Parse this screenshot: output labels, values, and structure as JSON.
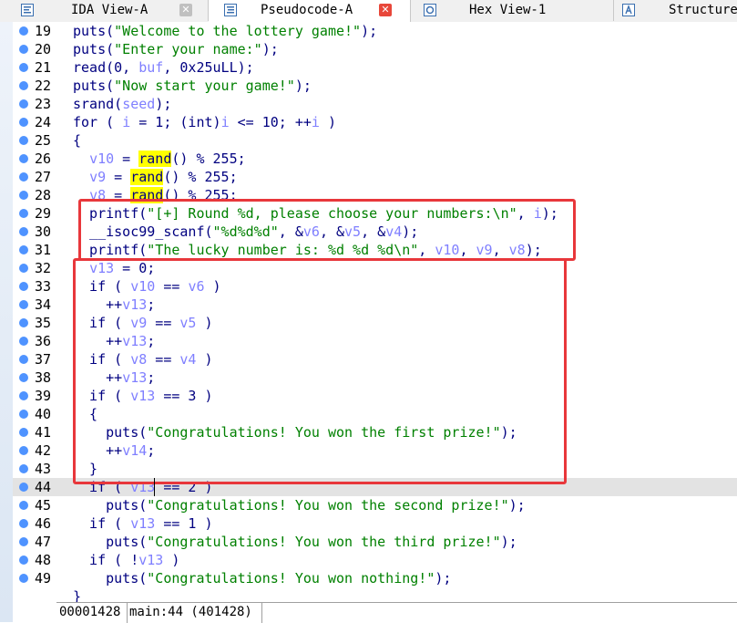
{
  "tabs": [
    {
      "label": "IDA View-A",
      "icon": "ida-view-icon",
      "close": "✕",
      "close_color": "#c0c0c0",
      "active": false
    },
    {
      "label": "Pseudocode-A",
      "icon": "pseudocode-icon",
      "close": "✕",
      "close_color": "#e8473a",
      "active": true
    },
    {
      "label": "Hex View-1",
      "icon": "hex-view-icon",
      "close": "",
      "active": false
    },
    {
      "label": "Structure",
      "icon": "structures-icon",
      "close": "",
      "active": false
    }
  ],
  "code_lines": [
    {
      "no": "19",
      "segs": [
        {
          "t": "puts(",
          "c": "n"
        },
        {
          "t": "\"Welcome to the lottery game!\"",
          "c": "s"
        },
        {
          "t": ");",
          "c": "n"
        }
      ]
    },
    {
      "no": "20",
      "segs": [
        {
          "t": "puts(",
          "c": "n"
        },
        {
          "t": "\"Enter your name:\"",
          "c": "s"
        },
        {
          "t": ");",
          "c": "n"
        }
      ]
    },
    {
      "no": "21",
      "segs": [
        {
          "t": "read(0, ",
          "c": "n"
        },
        {
          "t": "buf",
          "c": "v"
        },
        {
          "t": ", 0x25uLL);",
          "c": "n"
        }
      ]
    },
    {
      "no": "22",
      "segs": [
        {
          "t": "puts(",
          "c": "n"
        },
        {
          "t": "\"Now start your game!\"",
          "c": "s"
        },
        {
          "t": ");",
          "c": "n"
        }
      ]
    },
    {
      "no": "23",
      "segs": [
        {
          "t": "srand(",
          "c": "n"
        },
        {
          "t": "seed",
          "c": "v"
        },
        {
          "t": ");",
          "c": "n"
        }
      ]
    },
    {
      "no": "24",
      "segs": [
        {
          "t": "for ( ",
          "c": "n"
        },
        {
          "t": "i",
          "c": "v"
        },
        {
          "t": " = 1; (int)",
          "c": "n"
        },
        {
          "t": "i",
          "c": "v"
        },
        {
          "t": " <= 10; ++",
          "c": "n"
        },
        {
          "t": "i",
          "c": "v"
        },
        {
          "t": " )",
          "c": "n"
        }
      ]
    },
    {
      "no": "25",
      "segs": [
        {
          "t": "{",
          "c": "n"
        }
      ]
    },
    {
      "no": "26",
      "segs": [
        {
          "t": "  ",
          "c": "n"
        },
        {
          "t": "v10",
          "c": "v"
        },
        {
          "t": " = ",
          "c": "n"
        },
        {
          "t": "rand",
          "c": "h"
        },
        {
          "t": "() % 255;",
          "c": "n"
        }
      ]
    },
    {
      "no": "27",
      "segs": [
        {
          "t": "  ",
          "c": "n"
        },
        {
          "t": "v9",
          "c": "v"
        },
        {
          "t": " = ",
          "c": "n"
        },
        {
          "t": "rand",
          "c": "h"
        },
        {
          "t": "() % 255;",
          "c": "n"
        }
      ]
    },
    {
      "no": "28",
      "segs": [
        {
          "t": "  ",
          "c": "n"
        },
        {
          "t": "v8",
          "c": "v"
        },
        {
          "t": " = ",
          "c": "n"
        },
        {
          "t": "rand",
          "c": "h"
        },
        {
          "t": "() % 255;",
          "c": "n"
        }
      ]
    },
    {
      "no": "29",
      "segs": [
        {
          "t": "  printf(",
          "c": "n"
        },
        {
          "t": "\"[+] Round %d, please choose your numbers:\\n\"",
          "c": "s"
        },
        {
          "t": ", ",
          "c": "n"
        },
        {
          "t": "i",
          "c": "v"
        },
        {
          "t": ");",
          "c": "n"
        }
      ]
    },
    {
      "no": "30",
      "segs": [
        {
          "t": "  __isoc99_scanf(",
          "c": "n"
        },
        {
          "t": "\"%d%d%d\"",
          "c": "s"
        },
        {
          "t": ", &",
          "c": "n"
        },
        {
          "t": "v6",
          "c": "v"
        },
        {
          "t": ", &",
          "c": "n"
        },
        {
          "t": "v5",
          "c": "v"
        },
        {
          "t": ", &",
          "c": "n"
        },
        {
          "t": "v4",
          "c": "v"
        },
        {
          "t": ");",
          "c": "n"
        }
      ]
    },
    {
      "no": "31",
      "segs": [
        {
          "t": "  printf(",
          "c": "n"
        },
        {
          "t": "\"The lucky number is: %d %d %d\\n\"",
          "c": "s"
        },
        {
          "t": ", ",
          "c": "n"
        },
        {
          "t": "v10",
          "c": "v"
        },
        {
          "t": ", ",
          "c": "n"
        },
        {
          "t": "v9",
          "c": "v"
        },
        {
          "t": ", ",
          "c": "n"
        },
        {
          "t": "v8",
          "c": "v"
        },
        {
          "t": ");",
          "c": "n"
        }
      ]
    },
    {
      "no": "32",
      "segs": [
        {
          "t": "  ",
          "c": "n"
        },
        {
          "t": "v13",
          "c": "v"
        },
        {
          "t": " = 0;",
          "c": "n"
        }
      ]
    },
    {
      "no": "33",
      "segs": [
        {
          "t": "  if ( ",
          "c": "n"
        },
        {
          "t": "v10",
          "c": "v"
        },
        {
          "t": " == ",
          "c": "n"
        },
        {
          "t": "v6",
          "c": "v"
        },
        {
          "t": " )",
          "c": "n"
        }
      ]
    },
    {
      "no": "34",
      "segs": [
        {
          "t": "    ++",
          "c": "n"
        },
        {
          "t": "v13",
          "c": "v"
        },
        {
          "t": ";",
          "c": "n"
        }
      ]
    },
    {
      "no": "35",
      "segs": [
        {
          "t": "  if ( ",
          "c": "n"
        },
        {
          "t": "v9",
          "c": "v"
        },
        {
          "t": " == ",
          "c": "n"
        },
        {
          "t": "v5",
          "c": "v"
        },
        {
          "t": " )",
          "c": "n"
        }
      ]
    },
    {
      "no": "36",
      "segs": [
        {
          "t": "    ++",
          "c": "n"
        },
        {
          "t": "v13",
          "c": "v"
        },
        {
          "t": ";",
          "c": "n"
        }
      ]
    },
    {
      "no": "37",
      "segs": [
        {
          "t": "  if ( ",
          "c": "n"
        },
        {
          "t": "v8",
          "c": "v"
        },
        {
          "t": " == ",
          "c": "n"
        },
        {
          "t": "v4",
          "c": "v"
        },
        {
          "t": " )",
          "c": "n"
        }
      ]
    },
    {
      "no": "38",
      "segs": [
        {
          "t": "    ++",
          "c": "n"
        },
        {
          "t": "v13",
          "c": "v"
        },
        {
          "t": ";",
          "c": "n"
        }
      ]
    },
    {
      "no": "39",
      "segs": [
        {
          "t": "  if ( ",
          "c": "n"
        },
        {
          "t": "v13",
          "c": "v"
        },
        {
          "t": " == 3 )",
          "c": "n"
        }
      ]
    },
    {
      "no": "40",
      "segs": [
        {
          "t": "  {",
          "c": "n"
        }
      ]
    },
    {
      "no": "41",
      "segs": [
        {
          "t": "    puts(",
          "c": "n"
        },
        {
          "t": "\"Congratulations! You won the first prize!\"",
          "c": "s"
        },
        {
          "t": ");",
          "c": "n"
        }
      ]
    },
    {
      "no": "42",
      "segs": [
        {
          "t": "    ++",
          "c": "n"
        },
        {
          "t": "v14",
          "c": "v"
        },
        {
          "t": ";",
          "c": "n"
        }
      ]
    },
    {
      "no": "43",
      "segs": [
        {
          "t": "  }",
          "c": "n"
        }
      ]
    },
    {
      "no": "44",
      "segs": [
        {
          "t": "  if ( ",
          "c": "n"
        },
        {
          "t": "v13",
          "c": "v"
        },
        {
          "t": " == 2 )",
          "c": "n"
        }
      ],
      "current": true
    },
    {
      "no": "45",
      "segs": [
        {
          "t": "    puts(",
          "c": "n"
        },
        {
          "t": "\"Congratulations! You won the second prize!\"",
          "c": "s"
        },
        {
          "t": ");",
          "c": "n"
        }
      ]
    },
    {
      "no": "46",
      "segs": [
        {
          "t": "  if ( ",
          "c": "n"
        },
        {
          "t": "v13",
          "c": "v"
        },
        {
          "t": " == 1 )",
          "c": "n"
        }
      ]
    },
    {
      "no": "47",
      "segs": [
        {
          "t": "    puts(",
          "c": "n"
        },
        {
          "t": "\"Congratulations! You won the third prize!\"",
          "c": "s"
        },
        {
          "t": ");",
          "c": "n"
        }
      ]
    },
    {
      "no": "48",
      "segs": [
        {
          "t": "  if ( !",
          "c": "n"
        },
        {
          "t": "v13",
          "c": "v"
        },
        {
          "t": " )",
          "c": "n"
        }
      ]
    },
    {
      "no": "49",
      "segs": [
        {
          "t": "    puts(",
          "c": "n"
        },
        {
          "t": "\"Congratulations! You won nothing!\"",
          "c": "s"
        },
        {
          "t": ");",
          "c": "n"
        }
      ]
    },
    {
      "no": "",
      "segs": [
        {
          "t": "}",
          "c": "n"
        }
      ]
    }
  ],
  "status": {
    "address": "00001428",
    "location": "main:44 (401428)"
  },
  "colors": {
    "keyword": "#000080",
    "string": "#008000",
    "variable": "#7f7fff",
    "highlight": "#ffff00",
    "annotation_box": "#e8373b",
    "breakpoint_dot": "#4f93ff"
  }
}
